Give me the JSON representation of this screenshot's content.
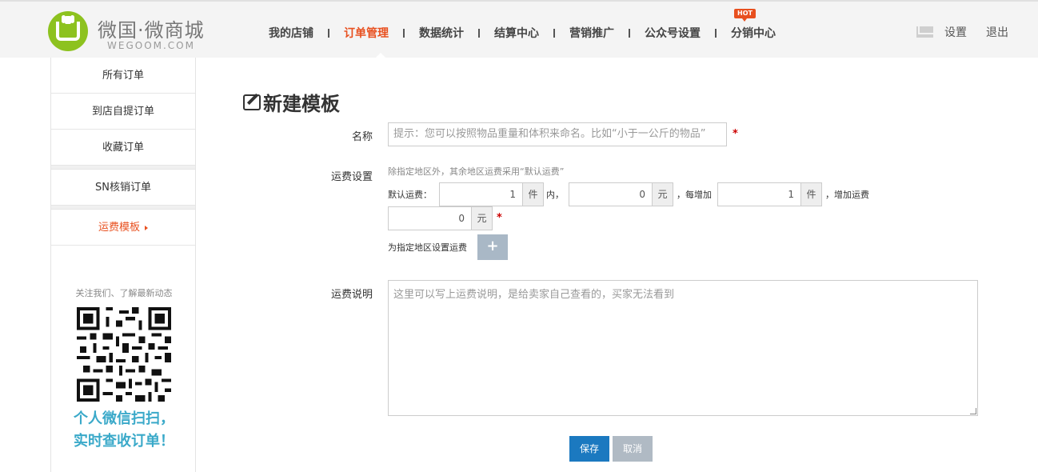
{
  "brand": {
    "title": "微国·微商城",
    "subtitle": "WEGOOM.COM"
  },
  "nav": {
    "items": [
      {
        "label": "我的店铺"
      },
      {
        "label": "订单管理",
        "active": true
      },
      {
        "label": "数据统计"
      },
      {
        "label": "结算中心"
      },
      {
        "label": "营销推广"
      },
      {
        "label": "公众号设置"
      },
      {
        "label": "分销中心",
        "badge": "HOT"
      }
    ],
    "settings_label": "设置",
    "logout_label": "退出"
  },
  "sidebar": {
    "items": [
      {
        "label": "所有订单"
      },
      {
        "label": "到店自提订单"
      },
      {
        "label": "收藏订单"
      },
      {
        "label": "SN核销订单"
      },
      {
        "label": "运费模板",
        "active": true
      }
    ],
    "follow_text": "关注我们、了解最新动态",
    "slogan_line1": "个人微信扫扫，",
    "slogan_line2": "实时查收订单！"
  },
  "form": {
    "title": "新建模板",
    "name_label": "名称",
    "name_placeholder": "提示：您可以按照物品重量和体积来命名。比如“小于一公斤的物品”",
    "required_mark": "*",
    "shipping_label": "运费设置",
    "shipping_hint": "除指定地区外，其余地区运费采用“默认运费”",
    "default_fee_label": "默认运费：",
    "first_qty": "1",
    "first_qty_unit": "件",
    "within_text": "内，",
    "first_fee": "0",
    "first_fee_unit": "元",
    "each_add_text": "，每增加",
    "add_qty": "1",
    "add_qty_unit": "件",
    "add_fee_text": "，增加运费",
    "add_fee": "0",
    "add_fee_unit": "元",
    "region_label": "为指定地区设置运费",
    "region_add_button": "+",
    "note_label": "运费说明",
    "note_placeholder": "这里可以写上运费说明，是给卖家自己查看的，买家无法看到",
    "save_label": "保存",
    "cancel_label": "取消"
  }
}
